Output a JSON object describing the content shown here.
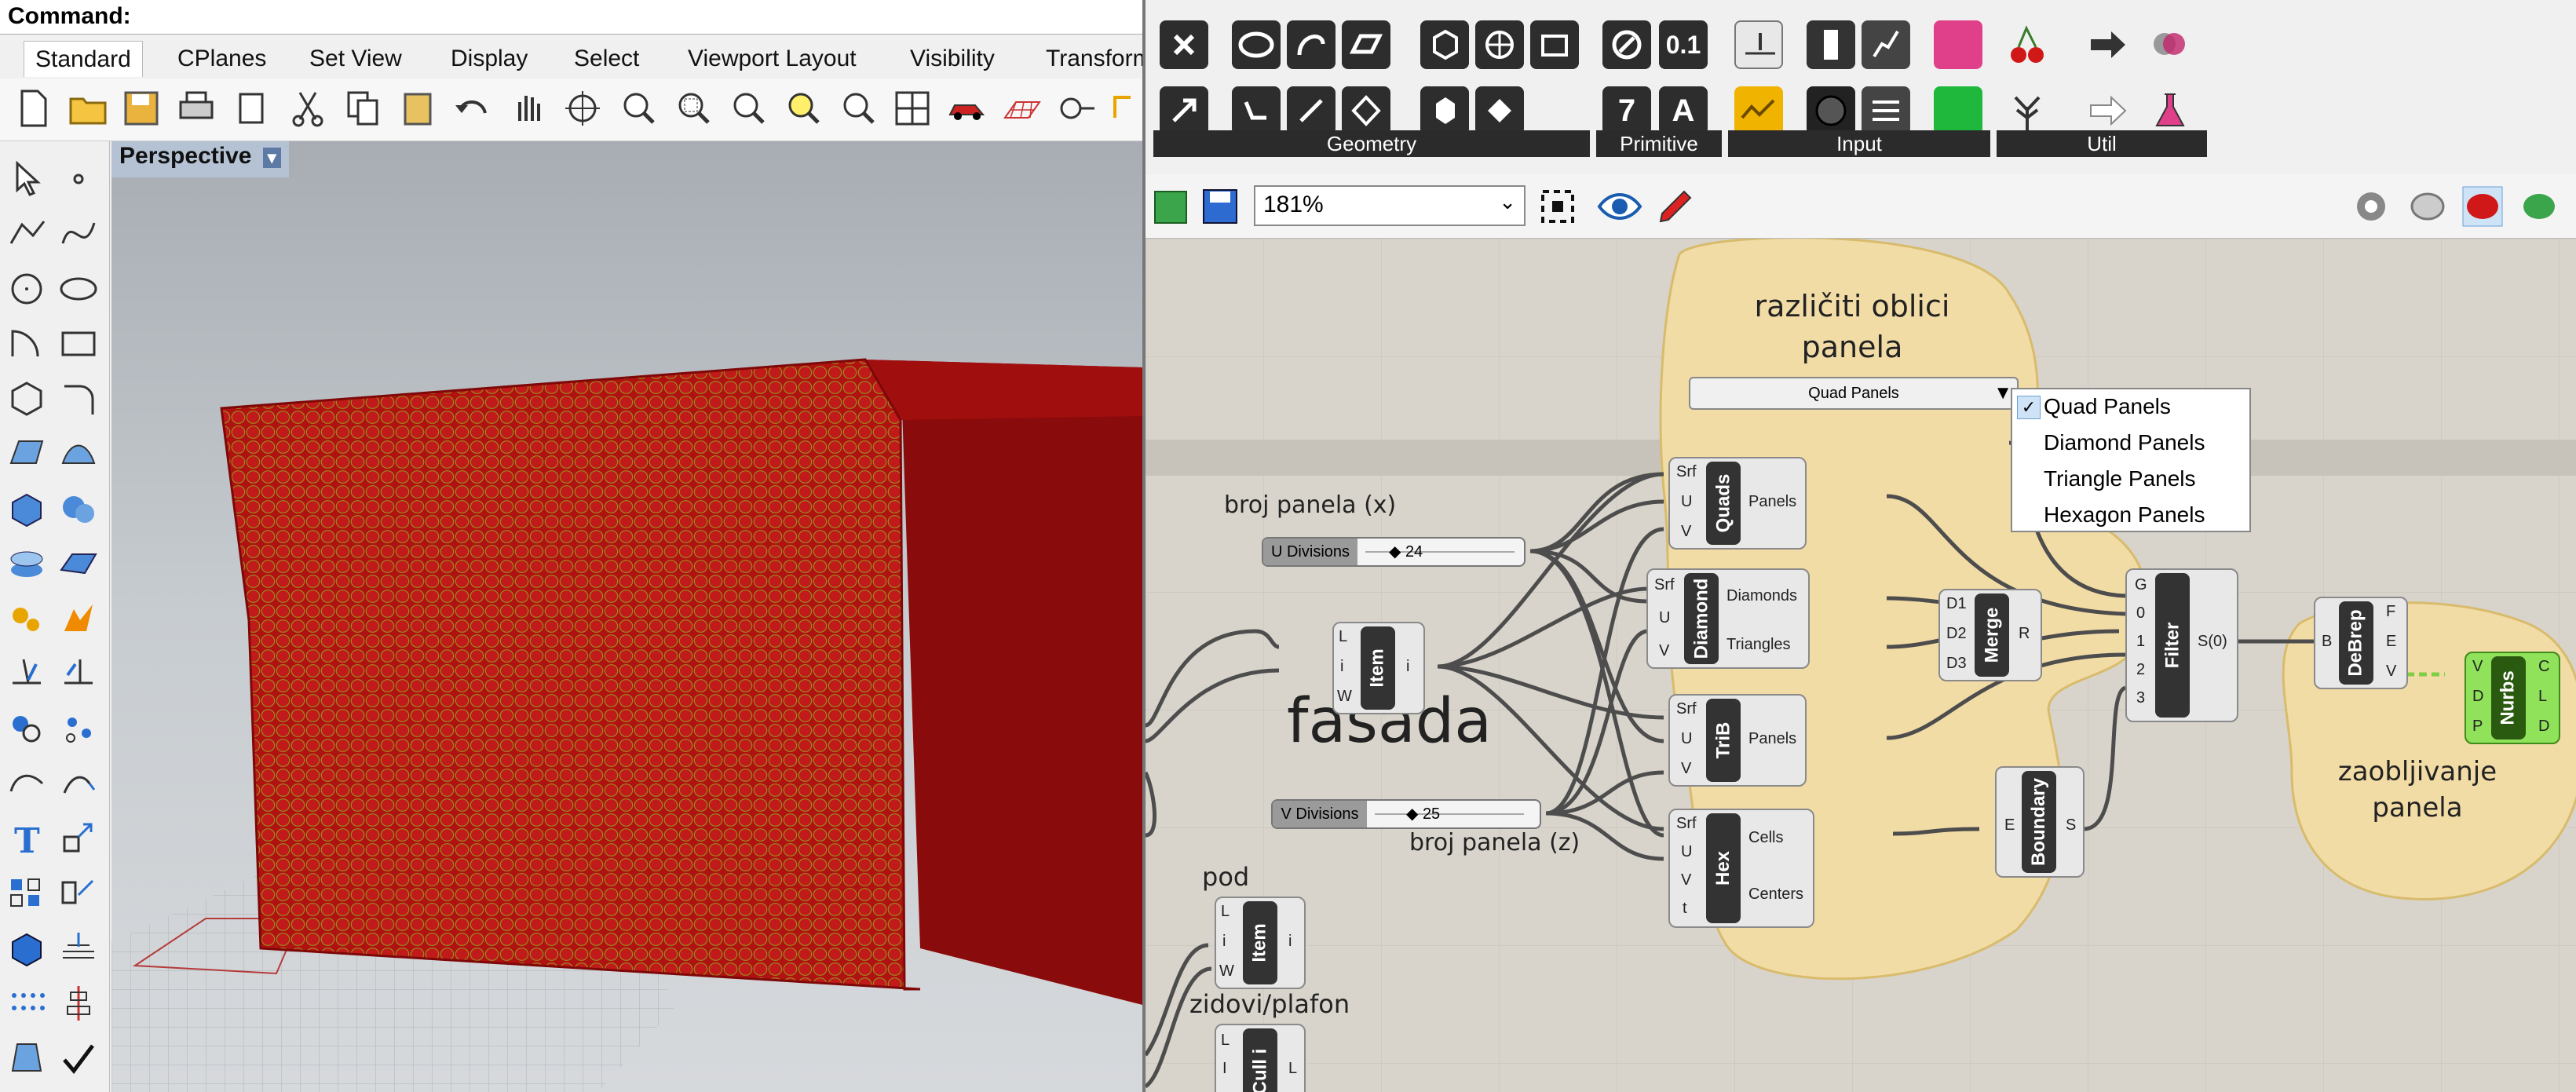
{
  "command": {
    "label": "Command:"
  },
  "rhino_tabs": [
    "Standard",
    "CPlanes",
    "Set View",
    "Display",
    "Select",
    "Viewport Layout",
    "Visibility",
    "Transform"
  ],
  "viewport": {
    "title": "Perspective"
  },
  "gh_ribbon": {
    "groups": [
      "Geometry",
      "Primitive",
      "Input",
      "Util"
    ],
    "primitive_labels": [
      "0.1",
      "7",
      "A"
    ]
  },
  "gh_toolbar": {
    "zoom": "181%"
  },
  "canvas": {
    "group1_title": "različiti oblici\npanela",
    "group2_title": "zaobljivanje\npanela",
    "dropdown": {
      "value": "Quad Panels",
      "options": [
        "Quad Panels",
        "Diamond Panels",
        "Triangle Panels",
        "Hexagon Panels"
      ],
      "checked": "Quad Panels"
    },
    "notes": {
      "broj_x": "broj panela (x)",
      "broj_z": "broj panela (z)",
      "fasada": "fasada",
      "pod": "pod",
      "zidovi": "zidovi/plafon"
    },
    "sliders": {
      "u": {
        "label": "U Divisions",
        "value": "24"
      },
      "v": {
        "label": "V Divisions",
        "value": "25"
      }
    },
    "components": {
      "quads": {
        "name": "Quads",
        "inputs": [
          "Srf",
          "U",
          "V"
        ],
        "outputs": [
          "Panels"
        ]
      },
      "diamond": {
        "name": "Diamond",
        "inputs": [
          "Srf",
          "U",
          "V"
        ],
        "outputs": [
          "Diamonds",
          "Triangles"
        ]
      },
      "trib": {
        "name": "TriB",
        "inputs": [
          "Srf",
          "U",
          "V"
        ],
        "outputs": [
          "Panels"
        ]
      },
      "hex": {
        "name": "Hex",
        "inputs": [
          "Srf",
          "U",
          "V",
          "t"
        ],
        "outputs": [
          "Cells",
          "Centers"
        ]
      },
      "merge": {
        "name": "Merge",
        "inputs": [
          "D1",
          "D2",
          "D3"
        ],
        "outputs": [
          "R"
        ]
      },
      "filter": {
        "name": "Filter",
        "inputs": [
          "G",
          "0",
          "1",
          "2",
          "3"
        ],
        "outputs": [
          "S(0)"
        ]
      },
      "boundary": {
        "name": "Boundary",
        "inputs": [
          "E"
        ],
        "outputs": [
          "S"
        ]
      },
      "debrep": {
        "name": "DeBrep",
        "inputs": [
          "B"
        ],
        "outputs": [
          "F",
          "E",
          "V"
        ]
      },
      "nurbs": {
        "name": "Nurbs",
        "inputs": [
          "V",
          "D",
          "P"
        ],
        "outputs": [
          "C",
          "L",
          "D"
        ]
      },
      "item1": {
        "name": "Item",
        "inputs": [
          "L",
          "i",
          "W"
        ],
        "outputs": [
          "i"
        ]
      },
      "item2": {
        "name": "Item",
        "inputs": [
          "L",
          "i",
          "W"
        ],
        "outputs": [
          "i"
        ]
      },
      "culli": {
        "name": "Cull i",
        "inputs": [
          "L",
          "I"
        ],
        "outputs": [
          "L"
        ]
      }
    }
  },
  "colors": {
    "facade": "#b01212",
    "group": "#f2dca6",
    "nurbs": "#79d94a"
  }
}
